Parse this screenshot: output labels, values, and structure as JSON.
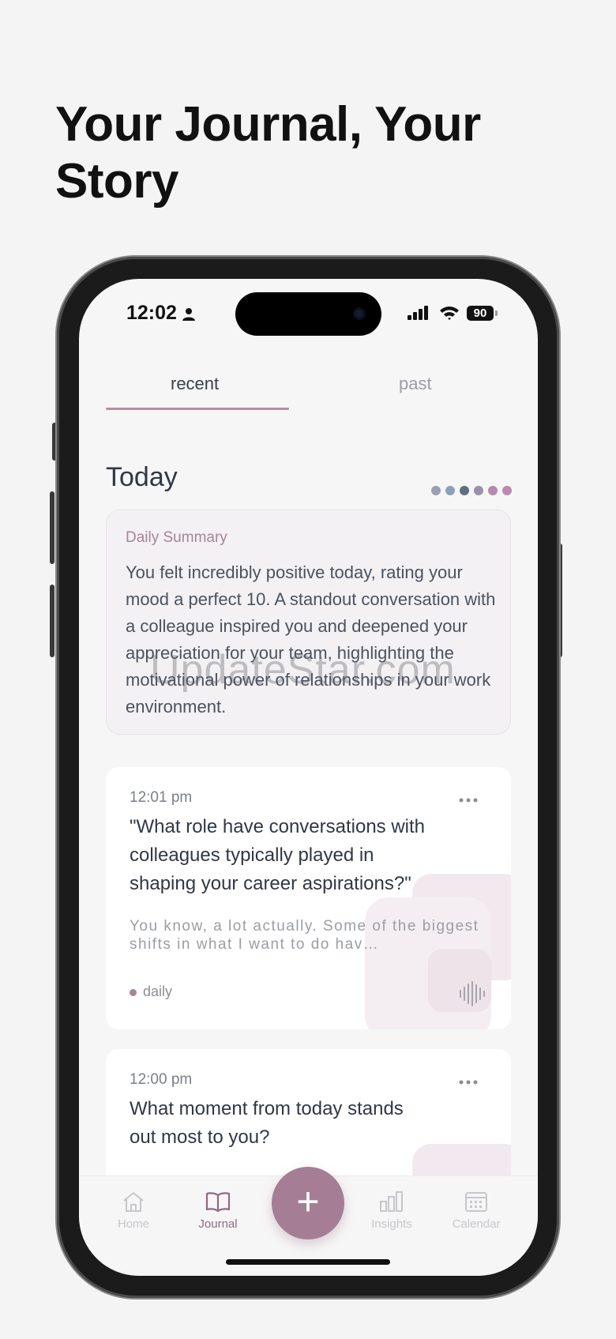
{
  "headline": "Your Journal, Your Story",
  "status_bar": {
    "time": "12:02",
    "battery": "90"
  },
  "tabs": [
    {
      "label": "recent",
      "active": true
    },
    {
      "label": "past",
      "active": false
    }
  ],
  "section_title": "Today",
  "mood_dots": [
    "#9a9fb3",
    "#8aa2b8",
    "#5f6f80",
    "#9b8fae",
    "#b48ab0",
    "#bf88ae"
  ],
  "summary": {
    "title": "Daily Summary",
    "text": "You felt incredibly positive today, rating your mood a perfect 10. A standout conversation with a colleague inspired you and deepened your appreciation for your team, highlighting the motivational power of relationships in your work environment."
  },
  "entries": [
    {
      "time": "12:01 pm",
      "question": "\"What role have conversations with colleagues typically played in shaping your career aspirations?\"",
      "answer": "You know, a lot actually. Some of the biggest shifts in what I want to do hav…",
      "tag": "daily"
    },
    {
      "time": "12:00 pm",
      "question": "What moment from today stands out most to you?"
    }
  ],
  "nav": {
    "home": "Home",
    "journal": "Journal",
    "add": "+",
    "insights": "Insights",
    "calendar": "Calendar"
  },
  "watermark": "UpdateStar.com",
  "colors": {
    "accent": "#a57e96",
    "text_dark": "#2f3846",
    "muted": "#9a9ea4"
  }
}
